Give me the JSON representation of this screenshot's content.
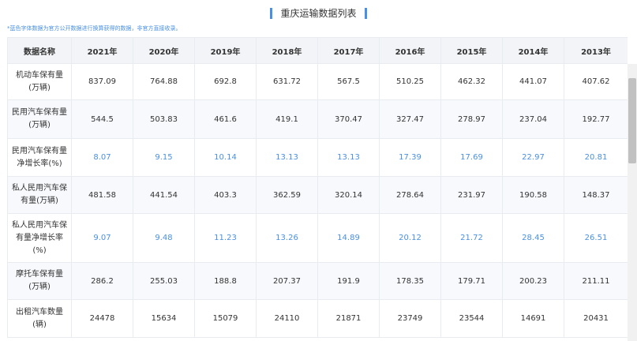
{
  "title": "重庆运输数据列表",
  "note": "*蓝色字体数据为官方公开数据进行换算获得的数据，非官方直接收录。",
  "table": {
    "headers": [
      "数据名称",
      "2021年",
      "2020年",
      "2019年",
      "2018年",
      "2017年",
      "2016年",
      "2015年",
      "2014年",
      "2013年"
    ],
    "rows": [
      {
        "label": "机动车保有量(万辆)",
        "values": [
          "837.09",
          "764.88",
          "692.8",
          "631.72",
          "567.5",
          "510.25",
          "462.32",
          "441.07",
          "407.62"
        ]
      },
      {
        "label": "民用汽车保有量(万辆)",
        "values": [
          "544.5",
          "503.83",
          "461.6",
          "419.1",
          "370.47",
          "327.47",
          "278.97",
          "237.04",
          "192.77"
        ]
      },
      {
        "label": "民用汽车保有量净增长率(%)",
        "values": [
          "8.07",
          "9.15",
          "10.14",
          "13.13",
          "13.13",
          "17.39",
          "17.69",
          "22.97",
          "20.81"
        ]
      },
      {
        "label": "私人民用汽车保有量(万辆)",
        "values": [
          "481.58",
          "441.54",
          "403.3",
          "362.59",
          "320.14",
          "278.64",
          "231.97",
          "190.58",
          "148.37"
        ]
      },
      {
        "label": "私人民用汽车保有量净增长率(%)",
        "values": [
          "9.07",
          "9.48",
          "11.23",
          "13.26",
          "14.89",
          "20.12",
          "21.72",
          "28.45",
          "26.51"
        ]
      },
      {
        "label": "摩托车保有量(万辆)",
        "values": [
          "286.2",
          "255.03",
          "188.8",
          "207.37",
          "191.9",
          "178.35",
          "179.71",
          "200.23",
          "211.11"
        ]
      },
      {
        "label": "出租汽车数量(辆)",
        "values": [
          "24478",
          "15634",
          "15079",
          "24110",
          "21871",
          "23749",
          "23544",
          "14691",
          "20431"
        ]
      }
    ]
  },
  "colors": {
    "accent": "#4a90e2",
    "header_bg": "#f2f4f7",
    "stripe_bg": "#f7f9fc"
  }
}
